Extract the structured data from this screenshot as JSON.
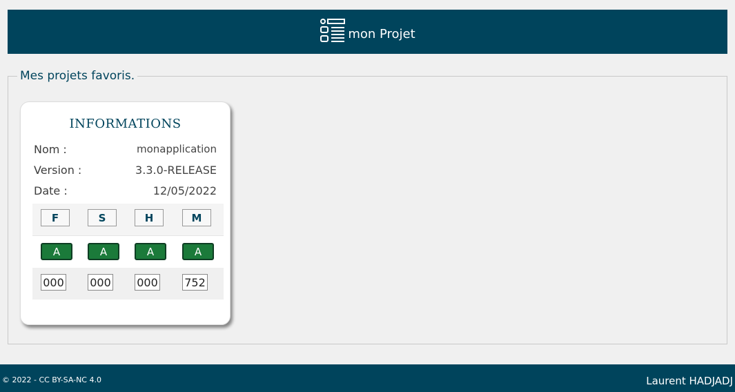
{
  "header": {
    "title": "mon Projet",
    "icon": "list-layout-icon",
    "bg_color": "#00445c"
  },
  "favorites": {
    "legend": "Mes projets favoris.",
    "card": {
      "title": "INFORMATIONS",
      "nom_label": "Nom :",
      "nom_value": "monapplication",
      "version_label": "Version :",
      "version_value": "3.3.0-RELEASE",
      "date_label": "Date :",
      "date_value": "12/05/2022",
      "metrics": [
        {
          "label": "F",
          "grade": "A",
          "count": "000"
        },
        {
          "label": "S",
          "grade": "A",
          "count": "000"
        },
        {
          "label": "H",
          "grade": "A",
          "count": "000"
        },
        {
          "label": "M",
          "grade": "A",
          "count": "752"
        }
      ],
      "grade_color": "#1b7a3a"
    }
  },
  "footer": {
    "copyright": "© 2022 - CC BY-SA-NC 4.0",
    "author": "Laurent HADJADJ"
  }
}
